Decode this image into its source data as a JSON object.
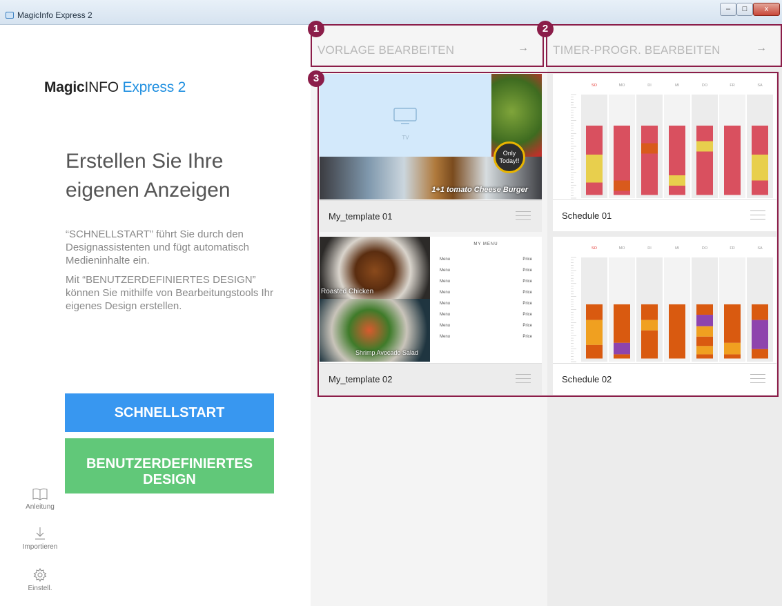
{
  "window": {
    "title": "MagicInfo Express 2",
    "min_glyph": "–",
    "max_glyph": "□",
    "close_glyph": "x"
  },
  "left": {
    "logo": {
      "part1": "Magic",
      "part2": "INFO",
      "part3": "Express 2"
    },
    "headline": "Erstellen Sie Ihre eigenen Anzeigen",
    "para1": "“SCHNELLSTART” führt Sie durch den Designassistenten und fügt automatisch Medieninhalte ein.",
    "para2": "Mit “BENUTZERDEFINIERTES DESIGN” können Sie mithilfe von Bearbeitungstools Ihr eigenes Design erstellen.",
    "quickstart_label": "SCHNELLSTART",
    "custom_label": "BENUTZERDEFINIERTES DESIGN",
    "tools": [
      {
        "label": "Anleitung",
        "icon": "book-icon"
      },
      {
        "label": "Importieren",
        "icon": "download-icon"
      },
      {
        "label": "Einstell.",
        "icon": "gear-icon"
      }
    ]
  },
  "actions": {
    "template": {
      "label": "VORLAGE BEARBEITEN",
      "arrow": "→",
      "badge": "1"
    },
    "timer": {
      "label": "TIMER-PROGR. BEARBEITEN",
      "arrow": "→",
      "badge": "2"
    },
    "grid_badge": "3"
  },
  "templates": [
    {
      "name": "My_template 01",
      "tv_label": "TV",
      "bubble": "Only Today!!",
      "caption": "1+1 tomato Cheese Burger"
    },
    {
      "name": "My_template 02",
      "caption_a": "Roasted Chicken",
      "caption_b": "Shrimp Avocado Salad",
      "menu_title": "MY MENU",
      "menu_rows": [
        {
          "item": "Menu",
          "price": "Price"
        },
        {
          "item": "Menu",
          "price": "Price"
        },
        {
          "item": "Menu",
          "price": "Price"
        },
        {
          "item": "Menu",
          "price": "Price"
        },
        {
          "item": "Menu",
          "price": "Price"
        },
        {
          "item": "Menu",
          "price": "Price"
        },
        {
          "item": "Menu",
          "price": "Price"
        },
        {
          "item": "Menu",
          "price": "Price"
        }
      ]
    }
  ],
  "schedules": [
    {
      "name": "Schedule 01",
      "days": [
        "SO",
        "MO",
        "DI",
        "MI",
        "DO",
        "FR",
        "SA"
      ],
      "colors": {
        "main": "#d9505f",
        "a": "#e8cf4d",
        "b": "#d95a1c"
      },
      "blocks": [
        [
          {
            "from": 0.3,
            "to": 0.58,
            "c": "main"
          },
          {
            "from": 0.58,
            "to": 0.85,
            "c": "a"
          },
          {
            "from": 0.85,
            "to": 0.97,
            "c": "main"
          }
        ],
        [
          {
            "from": 0.3,
            "to": 0.83,
            "c": "main"
          },
          {
            "from": 0.83,
            "to": 0.93,
            "c": "b"
          },
          {
            "from": 0.93,
            "to": 0.97,
            "c": "main"
          }
        ],
        [
          {
            "from": 0.3,
            "to": 0.47,
            "c": "main"
          },
          {
            "from": 0.47,
            "to": 0.57,
            "c": "b"
          },
          {
            "from": 0.57,
            "to": 0.97,
            "c": "main"
          }
        ],
        [
          {
            "from": 0.3,
            "to": 0.78,
            "c": "main"
          },
          {
            "from": 0.78,
            "to": 0.88,
            "c": "a"
          },
          {
            "from": 0.88,
            "to": 0.97,
            "c": "main"
          }
        ],
        [
          {
            "from": 0.3,
            "to": 0.45,
            "c": "main"
          },
          {
            "from": 0.45,
            "to": 0.55,
            "c": "a"
          },
          {
            "from": 0.55,
            "to": 0.97,
            "c": "main"
          }
        ],
        [
          {
            "from": 0.3,
            "to": 0.97,
            "c": "main"
          }
        ],
        [
          {
            "from": 0.3,
            "to": 0.58,
            "c": "main"
          },
          {
            "from": 0.58,
            "to": 0.83,
            "c": "a"
          },
          {
            "from": 0.83,
            "to": 0.97,
            "c": "main"
          }
        ]
      ]
    },
    {
      "name": "Schedule 02",
      "days": [
        "SO",
        "MO",
        "DI",
        "MI",
        "DO",
        "FR",
        "SA"
      ],
      "colors": {
        "main": "#d95a10",
        "a": "#f0a020",
        "b": "#8e44ad"
      },
      "blocks": [
        [
          {
            "from": 0.45,
            "to": 0.6,
            "c": "main"
          },
          {
            "from": 0.6,
            "to": 0.84,
            "c": "a"
          },
          {
            "from": 0.84,
            "to": 0.97,
            "c": "main"
          }
        ],
        [
          {
            "from": 0.45,
            "to": 0.82,
            "c": "main"
          },
          {
            "from": 0.82,
            "to": 0.93,
            "c": "b"
          },
          {
            "from": 0.93,
            "to": 0.97,
            "c": "main"
          }
        ],
        [
          {
            "from": 0.45,
            "to": 0.6,
            "c": "main"
          },
          {
            "from": 0.6,
            "to": 0.7,
            "c": "a"
          },
          {
            "from": 0.7,
            "to": 0.97,
            "c": "main"
          }
        ],
        [
          {
            "from": 0.45,
            "to": 0.97,
            "c": "main"
          }
        ],
        [
          {
            "from": 0.45,
            "to": 0.55,
            "c": "main"
          },
          {
            "from": 0.55,
            "to": 0.66,
            "c": "b"
          },
          {
            "from": 0.66,
            "to": 0.76,
            "c": "a"
          },
          {
            "from": 0.76,
            "to": 0.85,
            "c": "main"
          },
          {
            "from": 0.85,
            "to": 0.93,
            "c": "a"
          },
          {
            "from": 0.93,
            "to": 0.97,
            "c": "main"
          }
        ],
        [
          {
            "from": 0.45,
            "to": 0.82,
            "c": "main"
          },
          {
            "from": 0.82,
            "to": 0.93,
            "c": "a"
          },
          {
            "from": 0.93,
            "to": 0.97,
            "c": "main"
          }
        ],
        [
          {
            "from": 0.45,
            "to": 0.6,
            "c": "main"
          },
          {
            "from": 0.6,
            "to": 0.88,
            "c": "b"
          },
          {
            "from": 0.88,
            "to": 0.97,
            "c": "main"
          }
        ]
      ]
    }
  ],
  "colors": {
    "accent_border": "#8b1d49",
    "quickstart": "#3897f0",
    "custom": "#61c879",
    "weekend_label": "#e53935"
  }
}
